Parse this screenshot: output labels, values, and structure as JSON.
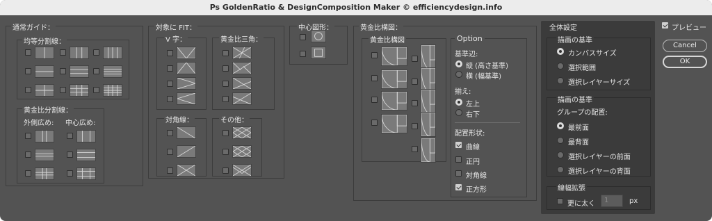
{
  "window": {
    "title": "Ps GoldenRatio & DesignComposition Maker © efficiencydesign.info"
  },
  "guides": {
    "title": "通常ガイド：",
    "equal_title": "均等分割線：",
    "golden_title": "黄金比分割線：",
    "outer_label": "外側広め:",
    "center_label": "中心広め:"
  },
  "fit": {
    "title": "対象に FIT：",
    "v_title": "V 字：",
    "gtri_title": "黄金比三角：",
    "diag_title": "対角線：",
    "other_title": "その他："
  },
  "center_shapes": {
    "title": "中心図形："
  },
  "golden_comp": {
    "title": "黄金比構図：",
    "inner_title": "黄金比構図"
  },
  "option": {
    "title": "Option",
    "base_side_label": "基準辺:",
    "vertical_label": "縦 (高さ基準)",
    "horizontal_label": "横 (幅基準)",
    "align_label": "揃え:",
    "top_left_label": "左上",
    "bottom_right_label": "右下",
    "shapes_label": "配置形状:",
    "curve_label": "曲線",
    "circle_label": "正円",
    "diagonal_label": "対角線",
    "square_label": "正方形",
    "curve_checked": true,
    "circle_checked": false,
    "diagonal_checked": false,
    "square_checked": true,
    "base_side_selected": "縦 (高さ基準)",
    "align_selected": "左上"
  },
  "global": {
    "title": "全体設定",
    "draw_base_label": "描画の基準",
    "canvas_size": "カンバスサイズ",
    "selection_range": "選択範囲",
    "selected_layer_size": "選択レイヤーサイズ",
    "draw_base2_label": "描画の基準",
    "group_placement_label": "グループの配置:",
    "front": "最前面",
    "back": "最背面",
    "front_of_layer": "選択レイヤーの前面",
    "back_of_layer": "選択レイヤーの背面",
    "stroke_label": "線幅拡張",
    "thicker_label": "更に太く",
    "thickness_value": "1",
    "unit": "px",
    "draw_base_selected": "カンバスサイズ",
    "placement_selected": "最前面"
  },
  "actions": {
    "preview_label": "プレビュー",
    "preview_checked": true,
    "cancel_label": "Cancel",
    "ok_label": "OK"
  }
}
